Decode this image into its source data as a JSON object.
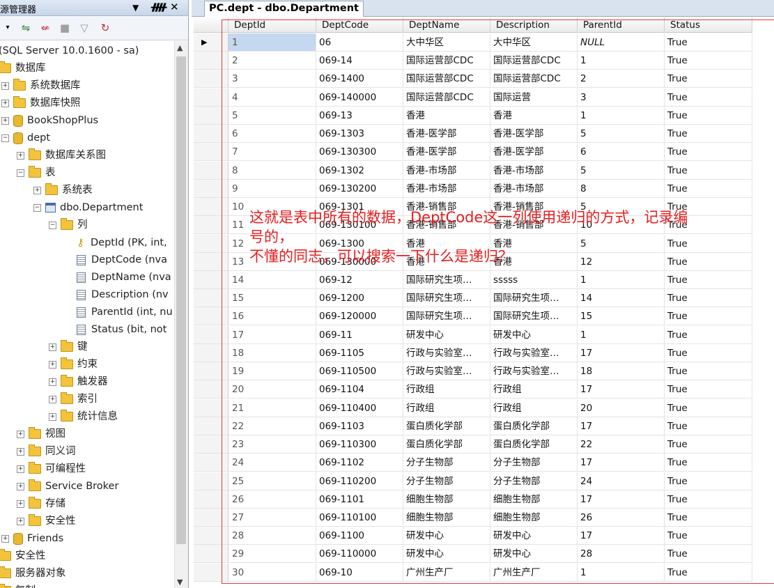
{
  "explorer": {
    "title": "源管理器",
    "pin": "ᚎ",
    "close": "✕",
    "dropdown_arrow": "▼",
    "toolbar_icons": [
      "connect-icon",
      "disconnect-icon",
      "stop-icon",
      "filter-icon",
      "refresh-icon"
    ],
    "tree": [
      {
        "label": "(SQL Server 10.0.1600 - sa)",
        "indent": 0,
        "type": "server"
      },
      {
        "label": "数据库",
        "indent": 0,
        "type": "folder"
      },
      {
        "label": "系统数据库",
        "indent": 1,
        "type": "folder",
        "expander": "+"
      },
      {
        "label": "数据库快照",
        "indent": 1,
        "type": "folder",
        "expander": "+"
      },
      {
        "label": "BookShopPlus",
        "indent": 1,
        "type": "db",
        "expander": "+"
      },
      {
        "label": "dept",
        "indent": 1,
        "type": "db",
        "expander": "−"
      },
      {
        "label": "数据库关系图",
        "indent": 2,
        "type": "folder",
        "expander": "+"
      },
      {
        "label": "表",
        "indent": 2,
        "type": "folder",
        "expander": "−"
      },
      {
        "label": "系统表",
        "indent": 3,
        "type": "folder",
        "expander": "+"
      },
      {
        "label": "dbo.Department",
        "indent": 3,
        "type": "table",
        "expander": "−"
      },
      {
        "label": "列",
        "indent": 4,
        "type": "folder",
        "expander": "−"
      },
      {
        "label": "DeptId (PK, int,",
        "indent": 5,
        "type": "key"
      },
      {
        "label": "DeptCode (nva",
        "indent": 5,
        "type": "column"
      },
      {
        "label": "DeptName (nva",
        "indent": 5,
        "type": "column"
      },
      {
        "label": "Description (nv",
        "indent": 5,
        "type": "column"
      },
      {
        "label": "ParentId (int, nu",
        "indent": 5,
        "type": "column"
      },
      {
        "label": "Status (bit, not",
        "indent": 5,
        "type": "column"
      },
      {
        "label": "键",
        "indent": 4,
        "type": "folder",
        "expander": "+"
      },
      {
        "label": "约束",
        "indent": 4,
        "type": "folder",
        "expander": "+"
      },
      {
        "label": "触发器",
        "indent": 4,
        "type": "folder",
        "expander": "+"
      },
      {
        "label": "索引",
        "indent": 4,
        "type": "folder",
        "expander": "+"
      },
      {
        "label": "统计信息",
        "indent": 4,
        "type": "folder",
        "expander": "+"
      },
      {
        "label": "视图",
        "indent": 2,
        "type": "folder",
        "expander": "+"
      },
      {
        "label": "同义词",
        "indent": 2,
        "type": "folder",
        "expander": "+"
      },
      {
        "label": "可编程性",
        "indent": 2,
        "type": "folder",
        "expander": "+"
      },
      {
        "label": "Service Broker",
        "indent": 2,
        "type": "folder",
        "expander": "+"
      },
      {
        "label": "存储",
        "indent": 2,
        "type": "folder",
        "expander": "+"
      },
      {
        "label": "安全性",
        "indent": 2,
        "type": "folder",
        "expander": "+"
      },
      {
        "label": "Friends",
        "indent": 1,
        "type": "db",
        "expander": "+"
      },
      {
        "label": "安全性",
        "indent": 0,
        "type": "folder"
      },
      {
        "label": "服务器对象",
        "indent": 0,
        "type": "folder"
      },
      {
        "label": "复制",
        "indent": 0,
        "type": "folder"
      }
    ],
    "scroll_up": "▲",
    "scroll_down": "▼"
  },
  "document": {
    "tab_title": "PC.dept - dbo.Department"
  },
  "grid": {
    "columns": [
      "DeptId",
      "DeptCode",
      "DeptName",
      "Description",
      "ParentId",
      "Status"
    ],
    "current_row_marker": "▶",
    "rows": [
      [
        "1",
        "06",
        "大中华区",
        "大中华区",
        "NULL",
        "True"
      ],
      [
        "2",
        "069-14",
        "国际运营部CDC",
        "国际运营部CDC",
        "1",
        "True"
      ],
      [
        "3",
        "069-1400",
        "国际运营部CDC",
        "国际运营部CDC",
        "2",
        "True"
      ],
      [
        "4",
        "069-140000",
        "国际运营部CDC",
        "国际运营",
        "3",
        "True"
      ],
      [
        "5",
        "069-13",
        "香港",
        "香港",
        "1",
        "True"
      ],
      [
        "6",
        "069-1303",
        "香港-医学部",
        "香港-医学部",
        "5",
        "True"
      ],
      [
        "7",
        "069-130300",
        "香港-医学部",
        "香港-医学部",
        "6",
        "True"
      ],
      [
        "8",
        "069-1302",
        "香港-市场部",
        "香港-市场部",
        "5",
        "True"
      ],
      [
        "9",
        "069-130200",
        "香港-市场部",
        "香港-市场部",
        "8",
        "True"
      ],
      [
        "10",
        "069-1301",
        "香港-销售部",
        "香港-销售部",
        "5",
        "True"
      ],
      [
        "11",
        "069-130100",
        "香港-销售部",
        "香港-销售部",
        "10",
        "True"
      ],
      [
        "12",
        "069-1300",
        "香港",
        "香港",
        "5",
        "True"
      ],
      [
        "13",
        "069-130000",
        "香港",
        "香港",
        "12",
        "True"
      ],
      [
        "14",
        "069-12",
        "国际研究生项…",
        "sssss",
        "1",
        "True"
      ],
      [
        "15",
        "069-1200",
        "国际研究生项…",
        "国际研究生项…",
        "14",
        "True"
      ],
      [
        "16",
        "069-120000",
        "国际研究生项…",
        "国际研究生项…",
        "15",
        "True"
      ],
      [
        "17",
        "069-11",
        "研发中心",
        "研发中心",
        "1",
        "True"
      ],
      [
        "18",
        "069-1105",
        "行政与实验室…",
        "行政与实验室…",
        "17",
        "True"
      ],
      [
        "19",
        "069-110500",
        "行政与实验室…",
        "行政与实验室…",
        "18",
        "True"
      ],
      [
        "20",
        "069-1104",
        "行政组",
        "行政组",
        "17",
        "True"
      ],
      [
        "21",
        "069-110400",
        "行政组",
        "行政组",
        "20",
        "True"
      ],
      [
        "22",
        "069-1103",
        "蛋白质化学部",
        "蛋白质化学部",
        "17",
        "True"
      ],
      [
        "23",
        "069-110300",
        "蛋白质化学部",
        "蛋白质化学部",
        "22",
        "True"
      ],
      [
        "24",
        "069-1102",
        "分子生物部",
        "分子生物部",
        "17",
        "True"
      ],
      [
        "25",
        "069-110200",
        "分子生物部",
        "分子生物部",
        "24",
        "True"
      ],
      [
        "26",
        "069-1101",
        "细胞生物部",
        "细胞生物部",
        "17",
        "True"
      ],
      [
        "27",
        "069-110100",
        "细胞生物部",
        "细胞生物部",
        "26",
        "True"
      ],
      [
        "28",
        "069-1100",
        "研发中心",
        "研发中心",
        "17",
        "True"
      ],
      [
        "29",
        "069-110000",
        "研发中心",
        "研发中心",
        "28",
        "True"
      ],
      [
        "30",
        "069-10",
        "广州生产厂",
        "广州生产厂",
        "1",
        "True"
      ]
    ]
  },
  "annotation": {
    "line1": "这就是表中所有的数据，DeptCode这一列使用递归的方式，记录编",
    "line2": "号的，",
    "line3": "不懂的同志，可以搜索一下什么是递归？"
  },
  "colors": {
    "annotation": "#e61e1e",
    "selection": "#c4d8f0",
    "folder": "#f2c33b"
  }
}
